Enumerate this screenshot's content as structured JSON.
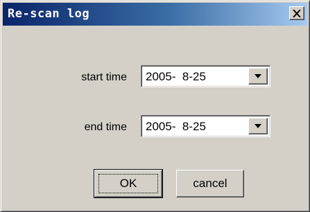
{
  "dialog": {
    "title": "Re-scan log",
    "start_label": "start time",
    "start_value": "2005-  8-25",
    "end_label": "end time",
    "end_value": "2005-  8-25",
    "ok_label": "OK",
    "cancel_label": "cancel"
  },
  "colors": {
    "titlebar_start": "#0a246a",
    "titlebar_end": "#a6caf0",
    "face": "#d4d0c8"
  },
  "icons": {
    "close": "close-icon",
    "dropdown": "chevron-down-icon"
  }
}
